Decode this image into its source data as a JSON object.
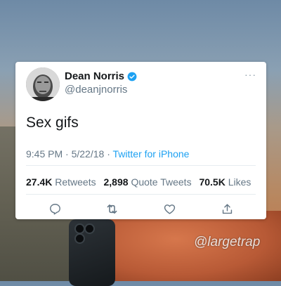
{
  "tweet": {
    "display_name": "Dean Norris",
    "handle": "@deanjnorris",
    "verified": true,
    "text": "Sex gifs",
    "time": "9:45 PM",
    "separator": "·",
    "date": "5/22/18",
    "separator2": "·",
    "source": "Twitter for iPhone",
    "retweets_count": "27.4K",
    "retweets_label": "Retweets",
    "quote_count": "2,898",
    "quote_label": "Quote Tweets",
    "likes_count": "70.5K",
    "likes_label": "Likes",
    "more_menu": "···"
  },
  "watermark": "@largetrap",
  "icons": {
    "reply": "reply-icon",
    "retweet": "retweet-icon",
    "like": "heart-icon",
    "share": "share-icon",
    "verified": "verified-badge-icon"
  },
  "colors": {
    "twitter_blue": "#1da1f2",
    "text_primary": "#14171a",
    "text_secondary": "#657786"
  }
}
